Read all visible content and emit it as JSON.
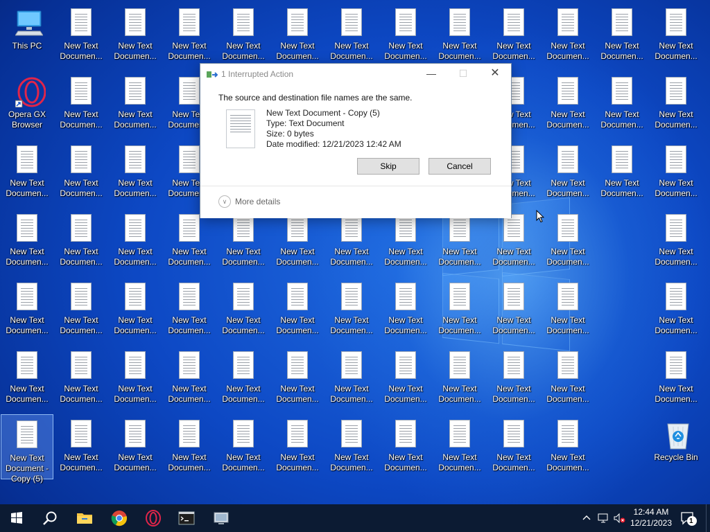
{
  "desktop": {
    "this_pc": "This PC",
    "opera": "Opera GX\nBrowser",
    "recycle_bin": "Recycle Bin",
    "doc_label": "New Text\nDocumen...",
    "selected_doc_label": "New Text\nDocument -\nCopy (5)"
  },
  "dialog": {
    "title": "1 Interrupted Action",
    "message": "The source and destination file names are the same.",
    "file_name": "New Text Document - Copy (5)",
    "file_type": "Type: Text Document",
    "file_size": "Size: 0 bytes",
    "file_date": "Date modified: 12/21/2023 12:42 AM",
    "skip_label": "Skip",
    "cancel_label": "Cancel",
    "more_details_label": "More details"
  },
  "taskbar": {
    "time": "12:44 AM",
    "date": "12/21/2023",
    "notification_count": "1",
    "apps": [
      "start-icon",
      "search-icon",
      "file-explorer-icon",
      "chrome-icon",
      "opera-gx-icon",
      "terminal-icon",
      "remote-desktop-icon"
    ]
  },
  "colors": {
    "taskbar": "#0c1b33",
    "desktop_blue": "#0d48c4",
    "button": "#e1e1e1"
  }
}
